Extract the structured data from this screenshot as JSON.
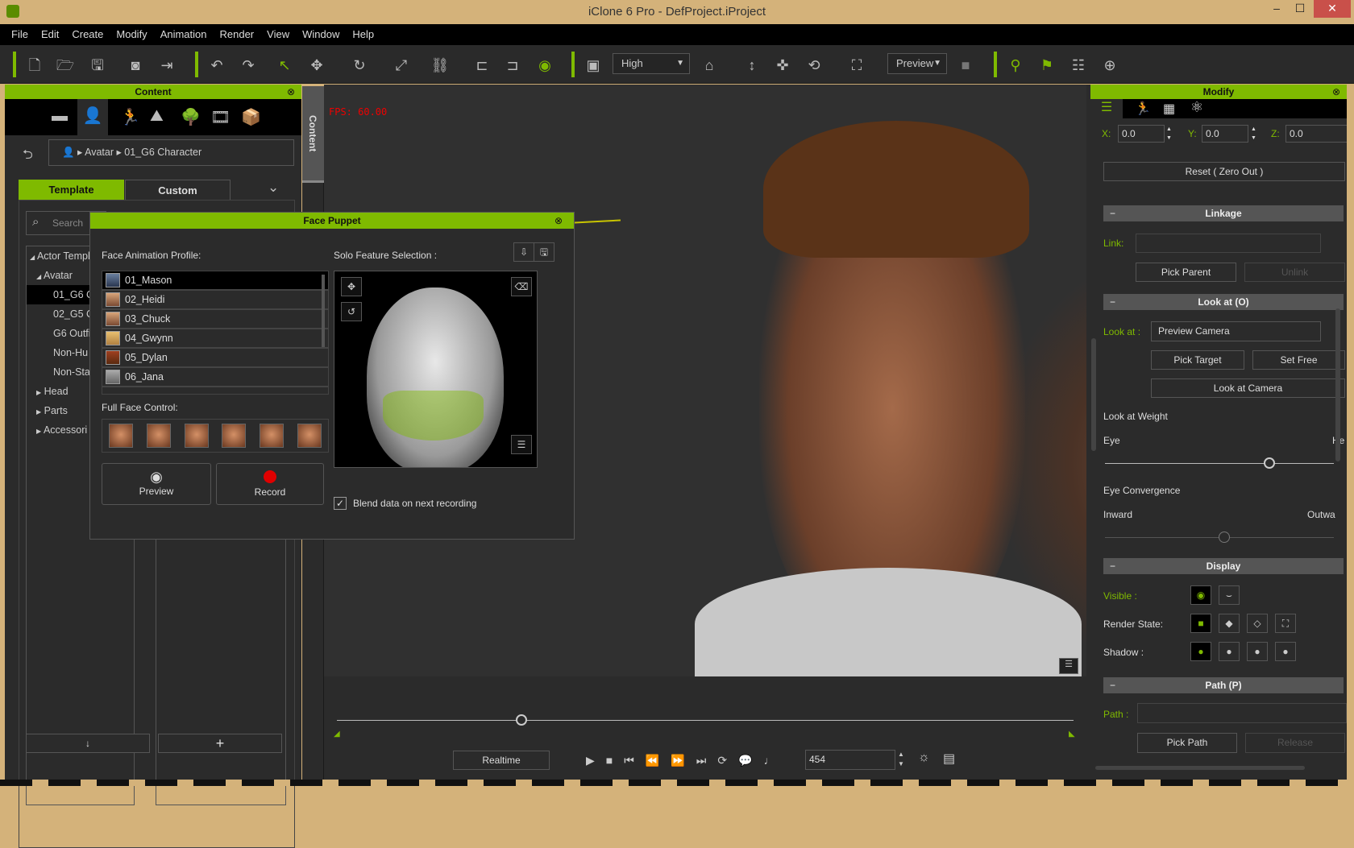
{
  "window": {
    "title": "iClone 6 Pro - DefProject.iProject",
    "minimize": "‒",
    "maximize": "☐",
    "close": "✕"
  },
  "menu": [
    "File",
    "Edit",
    "Create",
    "Modify",
    "Animation",
    "Render",
    "View",
    "Window",
    "Help"
  ],
  "toolbar": {
    "quality": "High",
    "camera": "Preview"
  },
  "content": {
    "title": "Content",
    "side_tab": "Content",
    "breadcrumb": [
      "Avatar",
      "01_G6 Character"
    ],
    "tabs": [
      "Template",
      "Custom"
    ],
    "search_placeholder": "Search",
    "tree": [
      {
        "label": "Actor Templ",
        "arrow": "◢"
      },
      {
        "label": "Avatar",
        "arrow": "◢"
      },
      {
        "label": "01_G6 C",
        "arrow": ""
      },
      {
        "label": "02_G5 C",
        "arrow": ""
      },
      {
        "label": "G6 Outfi",
        "arrow": ""
      },
      {
        "label": "Non-Hu",
        "arrow": ""
      },
      {
        "label": "Non-Sta",
        "arrow": ""
      },
      {
        "label": "Head",
        "arrow": "▶"
      },
      {
        "label": "Parts",
        "arrow": "▶"
      },
      {
        "label": "Accessori",
        "arrow": "▶"
      }
    ],
    "down_btn": "↓",
    "add_btn": "+"
  },
  "viewport": {
    "fps": "FPS: 60.00"
  },
  "face_puppet": {
    "title": "Face Puppet",
    "profile_label": "Face Animation Profile:",
    "profiles": [
      "01_Mason",
      "02_Heidi",
      "03_Chuck",
      "04_Gwynn",
      "05_Dylan",
      "06_Jana"
    ],
    "solo_label": "Solo Feature Selection :",
    "full_face_label": "Full Face Control:",
    "preview": "Preview",
    "record": "Record",
    "blend_label": "Blend data on next  recording",
    "blend_checked": true
  },
  "timeline": {
    "realtime": "Realtime",
    "frame": "454",
    "progress": 0.25
  },
  "modify": {
    "title": "Modify",
    "x_label": "X:",
    "y_label": "Y:",
    "z_label": "Z:",
    "x": "0.0",
    "y": "0.0",
    "z": "0.0",
    "reset": "Reset ( Zero Out )",
    "linkage": "Linkage",
    "link_label": "Link:",
    "pick_parent": "Pick Parent",
    "unlink": "Unlink",
    "lookat": "Look at  (O)",
    "lookat_label": "Look at :",
    "lookat_value": "Preview Camera",
    "pick_target": "Pick Target",
    "set_free": "Set Free",
    "look_at_camera": "Look at Camera",
    "weight_label": "Look at Weight",
    "eye": "Eye",
    "head": "He",
    "weight_value": 0.72,
    "convergence_label": "Eye Convergence",
    "inward": "Inward",
    "outward": "Outwa",
    "convergence_value": 0.52,
    "display": "Display",
    "visible_label": "Visible :",
    "render_label": "Render State:",
    "shadow_label": "Shadow :",
    "path": "Path  (P)",
    "path_label": "Path :",
    "pick_path": "Pick Path",
    "release": "Release"
  },
  "colors": {
    "accent": "#7fba00",
    "record": "#e00000"
  }
}
